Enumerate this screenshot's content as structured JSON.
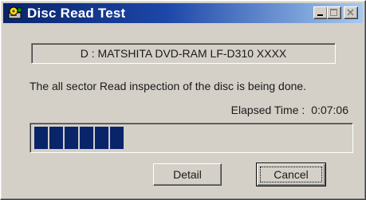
{
  "window": {
    "title": "Disc Read Test",
    "title_icon": "disc-drive-icon"
  },
  "title_buttons": {
    "minimize_icon": "minimize-icon",
    "maximize_icon": "maximize-icon",
    "close_icon": "close-icon"
  },
  "dialog": {
    "drive_label": "D : MATSHITA DVD-RAM LF-D310 XXXX",
    "message": "The all sector Read inspection of the disc is being done.",
    "elapsed_label": "Elapsed Time :",
    "elapsed_value": "0:07:06",
    "progress": {
      "filled_blocks": 6,
      "total_blocks": 27,
      "fraction": 0.22
    }
  },
  "buttons": {
    "detail": "Detail",
    "cancel": "Cancel"
  },
  "colors": {
    "title_gradient_start": "#0a246a",
    "title_gradient_end": "#a6caf0",
    "progress_block": "#0a246a",
    "face": "#d4d0c8"
  }
}
